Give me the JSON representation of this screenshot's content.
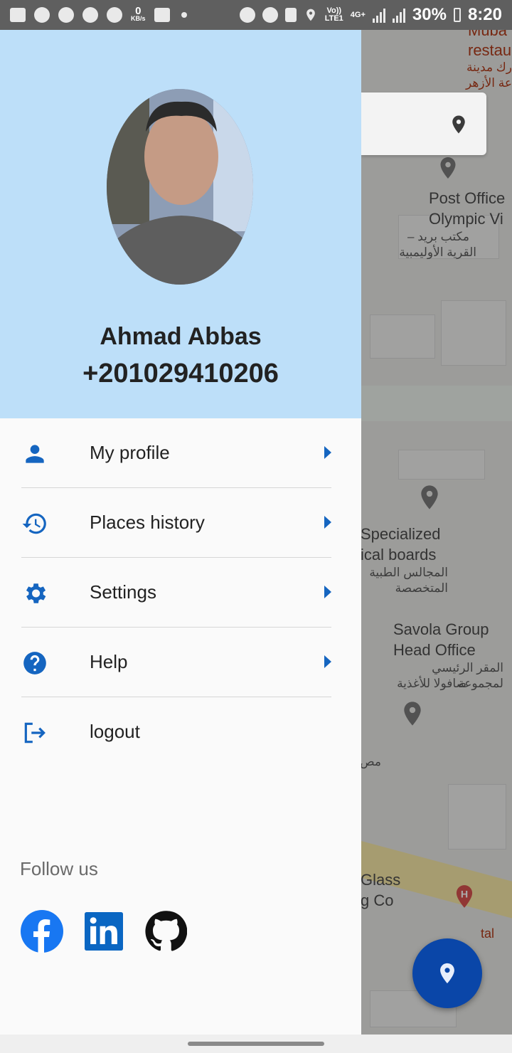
{
  "status_bar": {
    "kbs_value": "0",
    "kbs_unit": "KB/s",
    "volte": "Vo))",
    "lte": "LTE1",
    "network": "4G+",
    "battery": "30%",
    "time": "8:20"
  },
  "user": {
    "name": "Ahmad Abbas",
    "phone": "+201029410206"
  },
  "menu": [
    {
      "label": "My profile",
      "icon": "person-icon"
    },
    {
      "label": "Places history",
      "icon": "history-icon"
    },
    {
      "label": "Settings",
      "icon": "gear-icon"
    },
    {
      "label": "Help",
      "icon": "help-icon"
    },
    {
      "label": "logout",
      "icon": "logout-icon"
    }
  ],
  "follow": {
    "label": "Follow us",
    "networks": [
      "facebook-icon",
      "linkedin-icon",
      "github-icon"
    ]
  },
  "map": {
    "labels": {
      "top_label_1": "Muba",
      "top_label_2": "restau",
      "top_ar_1": "رك مدينة",
      "top_ar_2": "عة الأزهر",
      "post_office_1": "Post Office",
      "post_office_2": "Olympic Vi",
      "post_office_ar_1": "مكتب بريد –",
      "post_office_ar_2": "القرية الأوليمبية",
      "specialized_1": "Specialized",
      "specialized_2": "ical boards",
      "specialized_ar_1": "المجالس الطبية",
      "specialized_ar_2": "المتخصصة",
      "savola_1": "Savola Group",
      "savola_2": "Head Office",
      "savola_ar_1": "المقر الرئيسي لمجموعة",
      "savola_ar_2": "صافولا للأغذية",
      "misc_ar": "مص",
      "glass_1": "Glass",
      "glass_2": "g Co",
      "hospital_fragment": "tal"
    }
  },
  "colors": {
    "accent": "#1565c0",
    "header_bg": "#bddff9",
    "fab": "#0a46a8"
  }
}
